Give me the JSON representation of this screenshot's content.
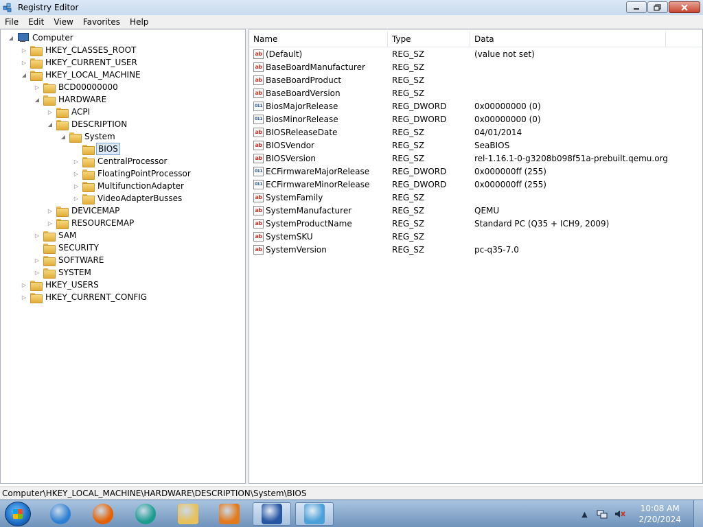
{
  "window": {
    "title": "Registry Editor"
  },
  "menu": [
    "File",
    "Edit",
    "View",
    "Favorites",
    "Help"
  ],
  "tree": [
    {
      "label": "Computer",
      "level": 0,
      "expander": "open",
      "icon": "computer"
    },
    {
      "label": "HKEY_CLASSES_ROOT",
      "level": 1,
      "expander": "closed"
    },
    {
      "label": "HKEY_CURRENT_USER",
      "level": 1,
      "expander": "closed"
    },
    {
      "label": "HKEY_LOCAL_MACHINE",
      "level": 1,
      "expander": "open"
    },
    {
      "label": "BCD00000000",
      "level": 2,
      "expander": "closed"
    },
    {
      "label": "HARDWARE",
      "level": 2,
      "expander": "open"
    },
    {
      "label": "ACPI",
      "level": 3,
      "expander": "closed"
    },
    {
      "label": "DESCRIPTION",
      "level": 3,
      "expander": "open"
    },
    {
      "label": "System",
      "level": 4,
      "expander": "open"
    },
    {
      "label": "BIOS",
      "level": 5,
      "expander": "none",
      "selected": true
    },
    {
      "label": "CentralProcessor",
      "level": 5,
      "expander": "closed"
    },
    {
      "label": "FloatingPointProcessor",
      "level": 5,
      "expander": "closed"
    },
    {
      "label": "MultifunctionAdapter",
      "level": 5,
      "expander": "closed"
    },
    {
      "label": "VideoAdapterBusses",
      "level": 5,
      "expander": "closed"
    },
    {
      "label": "DEVICEMAP",
      "level": 3,
      "expander": "closed"
    },
    {
      "label": "RESOURCEMAP",
      "level": 3,
      "expander": "closed"
    },
    {
      "label": "SAM",
      "level": 2,
      "expander": "closed"
    },
    {
      "label": "SECURITY",
      "level": 2,
      "expander": "none"
    },
    {
      "label": "SOFTWARE",
      "level": 2,
      "expander": "closed"
    },
    {
      "label": "SYSTEM",
      "level": 2,
      "expander": "closed"
    },
    {
      "label": "HKEY_USERS",
      "level": 1,
      "expander": "closed"
    },
    {
      "label": "HKEY_CURRENT_CONFIG",
      "level": 1,
      "expander": "closed"
    }
  ],
  "columns": [
    "Name",
    "Type",
    "Data"
  ],
  "values": [
    {
      "name": "(Default)",
      "type": "REG_SZ",
      "data": "(value not set)",
      "icon": "string"
    },
    {
      "name": "BaseBoardManufacturer",
      "type": "REG_SZ",
      "data": "",
      "icon": "string"
    },
    {
      "name": "BaseBoardProduct",
      "type": "REG_SZ",
      "data": "",
      "icon": "string"
    },
    {
      "name": "BaseBoardVersion",
      "type": "REG_SZ",
      "data": "",
      "icon": "string"
    },
    {
      "name": "BiosMajorRelease",
      "type": "REG_DWORD",
      "data": "0x00000000 (0)",
      "icon": "binary"
    },
    {
      "name": "BiosMinorRelease",
      "type": "REG_DWORD",
      "data": "0x00000000 (0)",
      "icon": "binary"
    },
    {
      "name": "BIOSReleaseDate",
      "type": "REG_SZ",
      "data": "04/01/2014",
      "icon": "string"
    },
    {
      "name": "BIOSVendor",
      "type": "REG_SZ",
      "data": "SeaBIOS",
      "icon": "string"
    },
    {
      "name": "BIOSVersion",
      "type": "REG_SZ",
      "data": "rel-1.16.1-0-g3208b098f51a-prebuilt.qemu.org",
      "icon": "string"
    },
    {
      "name": "ECFirmwareMajorRelease",
      "type": "REG_DWORD",
      "data": "0x000000ff (255)",
      "icon": "binary"
    },
    {
      "name": "ECFirmwareMinorRelease",
      "type": "REG_DWORD",
      "data": "0x000000ff (255)",
      "icon": "binary"
    },
    {
      "name": "SystemFamily",
      "type": "REG_SZ",
      "data": "",
      "icon": "string"
    },
    {
      "name": "SystemManufacturer",
      "type": "REG_SZ",
      "data": "QEMU",
      "icon": "string"
    },
    {
      "name": "SystemProductName",
      "type": "REG_SZ",
      "data": "Standard PC (Q35 + ICH9, 2009)",
      "icon": "string"
    },
    {
      "name": "SystemSKU",
      "type": "REG_SZ",
      "data": "",
      "icon": "string"
    },
    {
      "name": "SystemVersion",
      "type": "REG_SZ",
      "data": "pc-q35-7.0",
      "icon": "string"
    }
  ],
  "icon_glyphs": {
    "string": "ab",
    "binary": "011"
  },
  "status": {
    "path": "Computer\\HKEY_LOCAL_MACHINE\\HARDWARE\\DESCRIPTION\\System\\BIOS"
  },
  "taskbar": {
    "apps": [
      {
        "id": "internet-explorer",
        "color": "#2d7fd3"
      },
      {
        "id": "firefox",
        "color": "#e66000"
      },
      {
        "id": "app-teal",
        "color": "#1a9c8f"
      },
      {
        "id": "file-explorer",
        "color": "#e8c15a"
      },
      {
        "id": "media-player",
        "color": "#e37a1c"
      },
      {
        "id": "app-monitor",
        "color": "#2756a3",
        "active": true
      },
      {
        "id": "registry-editor",
        "color": "#4aa0d8",
        "active": true
      }
    ],
    "clock_time": "10:08 AM",
    "clock_date": "2/20/2024"
  }
}
